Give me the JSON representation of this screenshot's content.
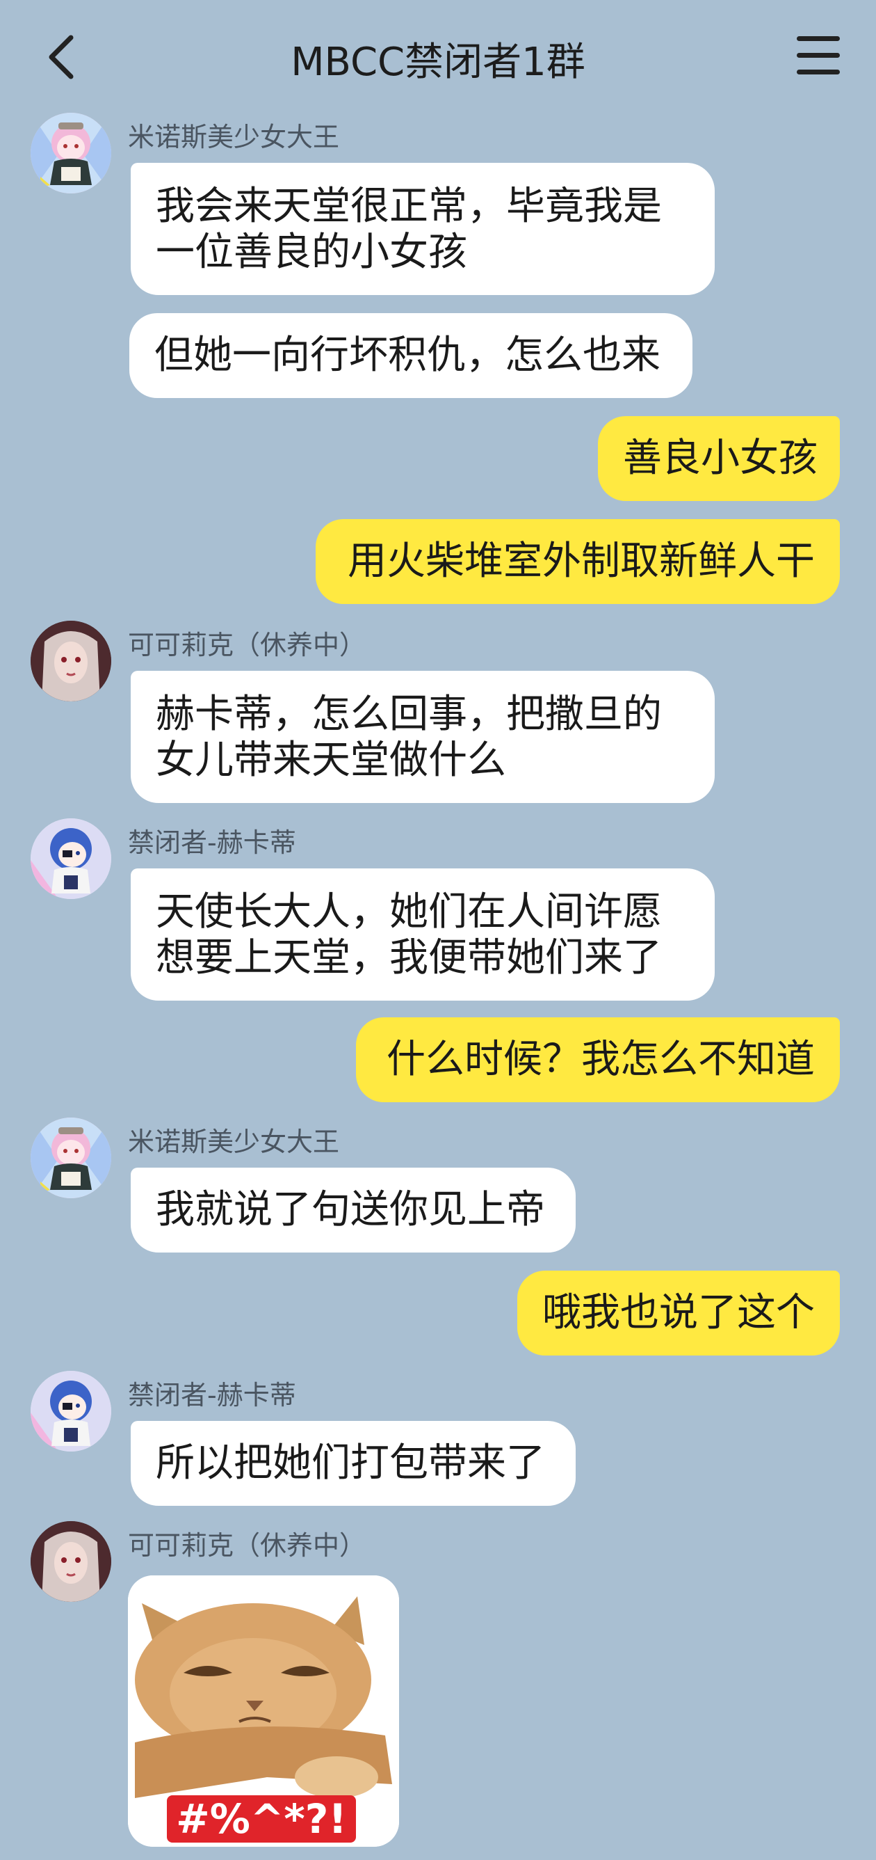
{
  "header": {
    "title": "MBCC禁闭者1群"
  },
  "messages": [
    {
      "sender": "米诺斯美少女大王",
      "bubbles": [
        "我会来天堂很正常，毕竟我是一位善良的小女孩",
        "但她一向行坏积仇，怎么也来"
      ],
      "lines": [
        "我会来天堂很正常，毕竟我是",
        "一位善良的小女孩"
      ]
    },
    {
      "sender": "me",
      "text": "善良小女孩"
    },
    {
      "sender": "me",
      "text": "用火柴堆室外制取新鲜人干"
    },
    {
      "sender": "可可莉克（休养中）",
      "lines": [
        "赫卡蒂，怎么回事，把撒旦的",
        "女儿带来天堂做什么"
      ]
    },
    {
      "sender": "禁闭者-赫卡蒂",
      "lines": [
        "天使长大人，她们在人间许愿",
        "想要上天堂，我便带她们来了"
      ]
    },
    {
      "sender": "me",
      "text": "什么时候？我怎么不知道"
    },
    {
      "sender": "米诺斯美少女大王",
      "text": "我就说了句送你见上帝"
    },
    {
      "sender": "me",
      "text": "哦我也说了这个"
    },
    {
      "sender": "禁闭者-赫卡蒂",
      "text": "所以把她们打包带来了"
    },
    {
      "sender": "可可莉克（休养中）",
      "sticker": {
        "subject": "grumpy-cat",
        "caption": "#%^*?!"
      }
    }
  ],
  "colors": {
    "background": "#a9bfd2",
    "incoming_bubble": "#ffffff",
    "outgoing_bubble": "#ffe941",
    "sender_name": "#4a5561"
  }
}
